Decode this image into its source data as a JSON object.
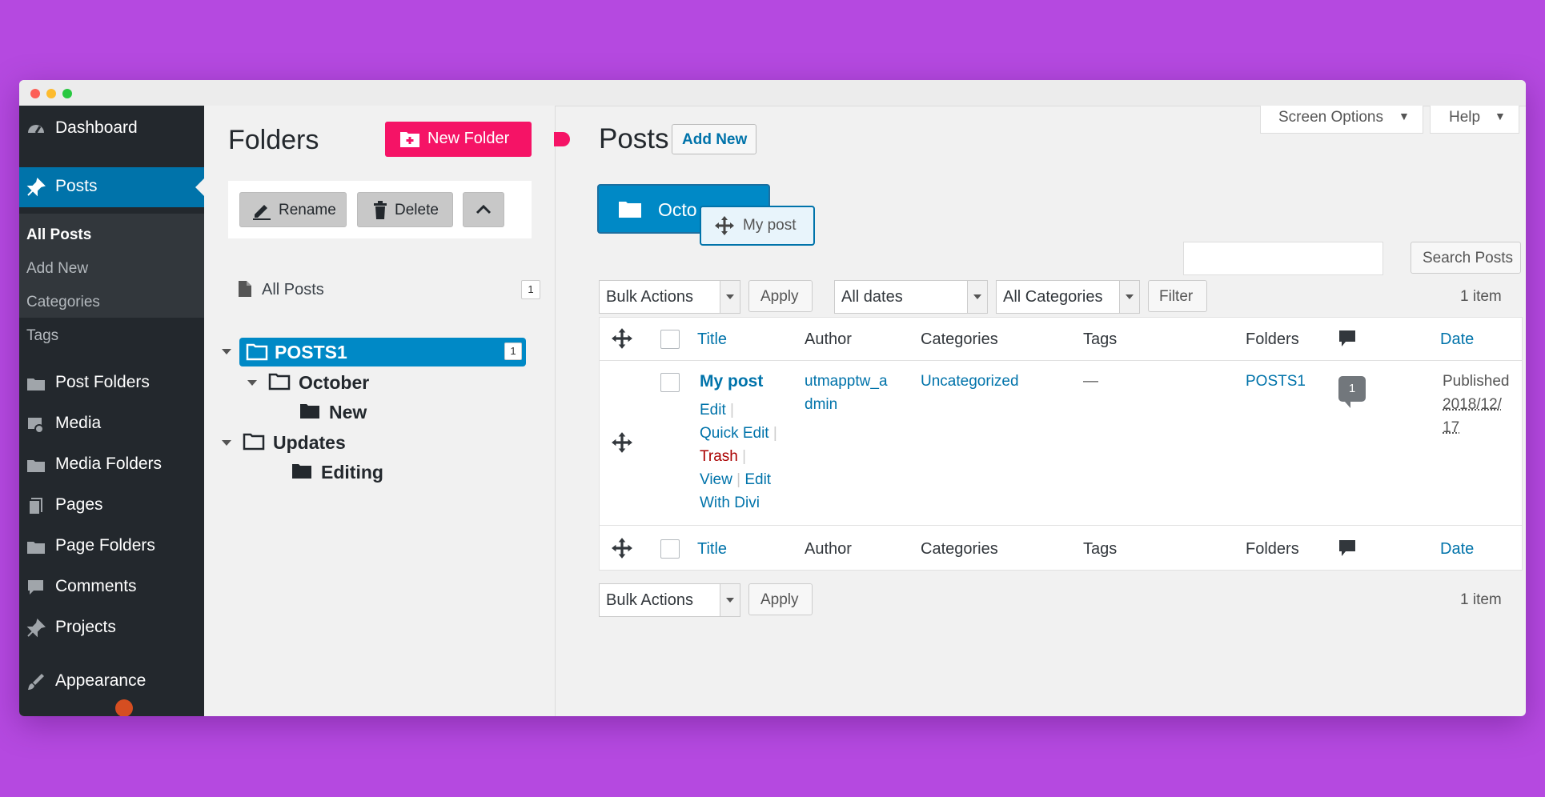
{
  "sidebar": {
    "items": [
      {
        "label": "Dashboard",
        "icon": "dashboard-icon"
      },
      {
        "label": "Posts",
        "icon": "pin-icon"
      },
      {
        "label": "Post Folders",
        "icon": "folder-icon"
      },
      {
        "label": "Media",
        "icon": "media-icon"
      },
      {
        "label": "Media Folders",
        "icon": "folder-icon"
      },
      {
        "label": "Pages",
        "icon": "pages-icon"
      },
      {
        "label": "Page Folders",
        "icon": "folder-icon"
      },
      {
        "label": "Comments",
        "icon": "comment-icon"
      },
      {
        "label": "Projects",
        "icon": "pin-icon"
      },
      {
        "label": "Appearance",
        "icon": "brush-icon"
      }
    ],
    "sub": [
      "All Posts",
      "Add New",
      "Categories",
      "Tags"
    ]
  },
  "folders": {
    "title": "Folders",
    "new_folder": "New Folder",
    "rename": "Rename",
    "delete": "Delete",
    "all_posts": "All Posts",
    "all_posts_count": "1",
    "tree": {
      "posts1": "POSTS1",
      "posts1_count": "1",
      "october": "October",
      "new": "New",
      "updates": "Updates",
      "editing": "Editing"
    }
  },
  "main": {
    "screen_options": "Screen Options",
    "help": "Help",
    "title": "Posts",
    "add_new": "Add New",
    "drag_folder": "Octo",
    "drag_post": "My post",
    "search_button": "Search Posts",
    "bulk_actions": "Bulk Actions",
    "apply": "Apply",
    "all_dates": "All dates",
    "all_categories": "All Categories",
    "filter": "Filter",
    "items_count": "1 item",
    "columns": {
      "title": "Title",
      "author": "Author",
      "categories": "Categories",
      "tags": "Tags",
      "folders": "Folders",
      "date": "Date"
    },
    "row": {
      "title": "My post",
      "edit": "Edit",
      "quick_edit": "Quick Edit",
      "trash": "Trash",
      "view": "View",
      "edit2": "Edit",
      "with_divi": "With Divi",
      "author_line1": "utmapptw_a",
      "author_line2": "dmin",
      "category": "Uncategorized",
      "tags": "—",
      "folder": "POSTS1",
      "comments": "1",
      "date_status": "Published",
      "date_line1": "2018/12/",
      "date_line2": "17"
    }
  },
  "colors": {
    "accent": "#0073aa",
    "selection": "#0089c6",
    "new_folder": "#f51366",
    "sidebar_bg": "#23282d",
    "background": "#b549e0"
  }
}
